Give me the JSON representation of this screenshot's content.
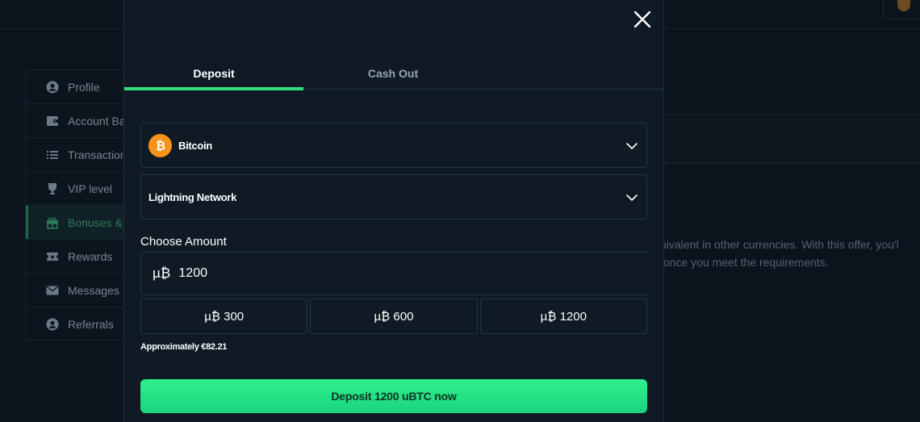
{
  "background": {
    "sidebar": {
      "items": [
        {
          "label": "Profile",
          "icon": "user-circle-icon",
          "active": false
        },
        {
          "label": "Account Ba",
          "icon": "wallet-icon",
          "active": false
        },
        {
          "label": "Transaction",
          "icon": "list-icon",
          "active": false
        },
        {
          "label": "VIP level",
          "icon": "trophy-icon",
          "active": false
        },
        {
          "label": "Bonuses &",
          "icon": "gift-icon",
          "active": true
        },
        {
          "label": "Rewards",
          "icon": "ticket-icon",
          "active": false
        },
        {
          "label": "Messages",
          "icon": "envelope-icon",
          "active": false
        },
        {
          "label": "Referrals",
          "icon": "user-circle-icon",
          "active": false
        }
      ]
    },
    "text_line1": "uivalent in other currencies. With this offer, you'l",
    "text_line2": " once you meet the requirements."
  },
  "modal": {
    "tabs": [
      {
        "label": "Deposit",
        "active": true
      },
      {
        "label": "Cash Out",
        "active": false
      }
    ],
    "currency_select": {
      "value": "Bitcoin",
      "icon": "bitcoin-icon"
    },
    "network_select": {
      "value": "Lightning Network"
    },
    "choose_amount_label": "Choose Amount",
    "amount_input": {
      "unit": "µ₿",
      "value": "1200"
    },
    "presets": [
      {
        "label": "µ₿ 300"
      },
      {
        "label": "µ₿ 600"
      },
      {
        "label": "µ₿ 1200"
      }
    ],
    "approximate_text": "Approximately €82.21",
    "deposit_button": "Deposit 1200 uBTC now"
  },
  "colors": {
    "accent": "#2fe07c",
    "bitcoin": "#f7931a",
    "modal_bg": "#0f1a24",
    "page_bg": "#0b141c"
  }
}
